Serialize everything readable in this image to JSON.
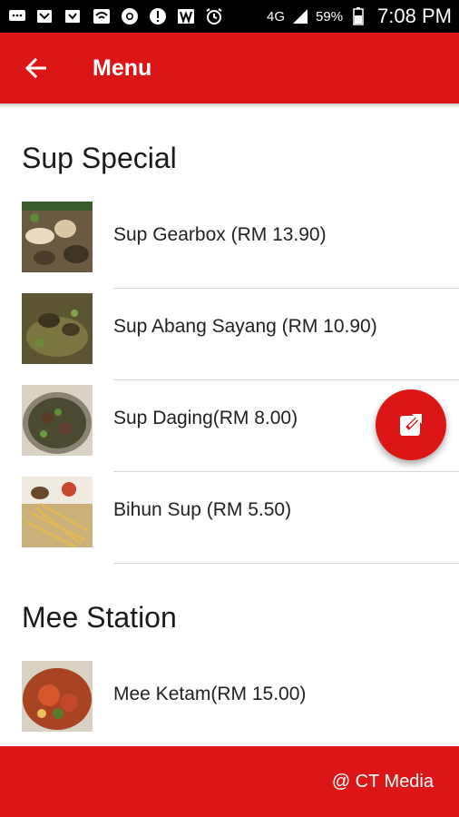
{
  "status_bar": {
    "network": "4G",
    "battery": "59%",
    "time": "7:08 PM"
  },
  "app_bar": {
    "title": "Menu"
  },
  "sections": [
    {
      "title": "Sup Special",
      "items": [
        {
          "label": "Sup Gearbox (RM 13.90)"
        },
        {
          "label": "Sup Abang Sayang (RM 10.90)"
        },
        {
          "label": "Sup Daging(RM 8.00)"
        },
        {
          "label": "Bihun Sup (RM 5.50)"
        }
      ]
    },
    {
      "title": "Mee Station",
      "items": [
        {
          "label": "Mee Ketam(RM 15.00)"
        }
      ]
    }
  ],
  "footer": {
    "text": "@ CT Media"
  },
  "colors": {
    "primary": "#dc1616",
    "background": "#ffffff",
    "divider": "#d6d6d6"
  },
  "icons": {
    "back": "arrow-left-icon",
    "fab": "edit-external-icon"
  }
}
